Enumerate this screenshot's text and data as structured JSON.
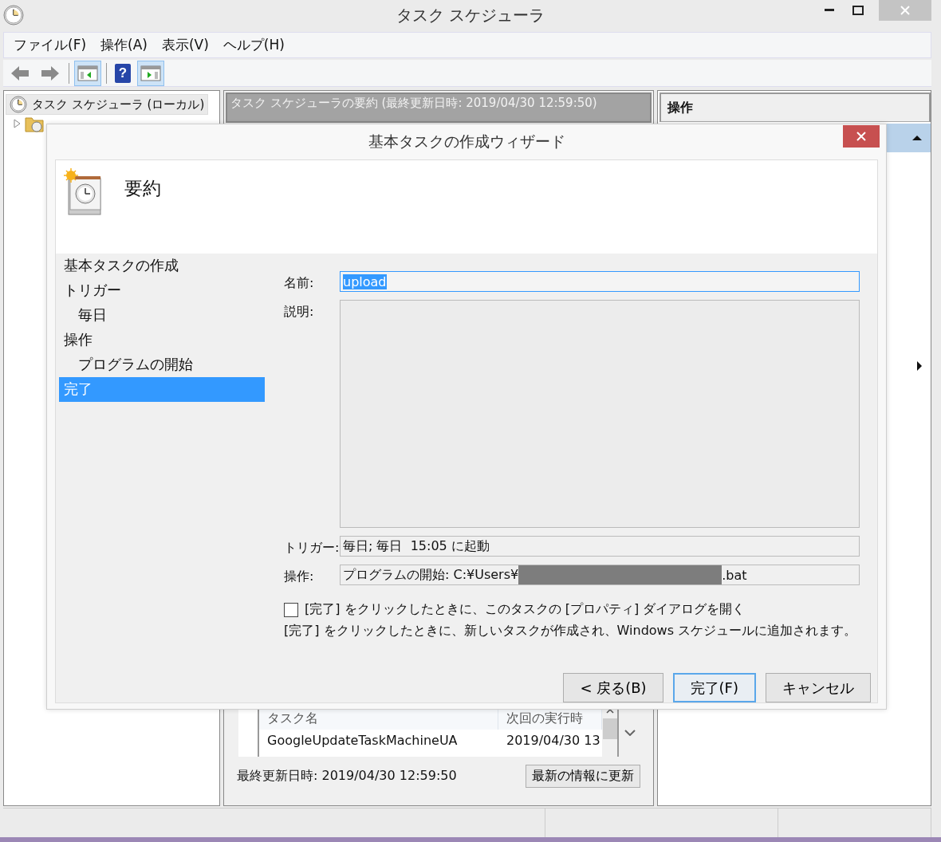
{
  "window": {
    "title": "タスク スケジューラ"
  },
  "menu": [
    "ファイル(F)",
    "操作(A)",
    "表示(V)",
    "ヘルプ(H)"
  ],
  "toolbar": [
    {
      "kind": "back",
      "on": false
    },
    {
      "kind": "forward",
      "on": false
    },
    {
      "kind": "console-tree",
      "on": true
    },
    {
      "kind": "help",
      "on": false,
      "glyph": "?"
    },
    {
      "kind": "action-pane",
      "on": true
    }
  ],
  "tree": [
    {
      "label": "タスク スケジューラ (ローカル)",
      "selected": true,
      "children": [
        {
          "expanded": false
        }
      ]
    }
  ],
  "summary": {
    "title": "タスク スケジューラの要約 (最終更新日時: 2019/04/30 12:59:50)",
    "table": {
      "columns": [
        "タスク名",
        "次回の実行時"
      ],
      "rows": [
        [
          "GoogleUpdateTaskMachineUA",
          "2019/04/30 13"
        ]
      ]
    },
    "last_updated": "最終更新日時: 2019/04/30 12:59:50",
    "refresh_button": "最新の情報に更新"
  },
  "actions_pane": {
    "title": "操作"
  },
  "dialog": {
    "title": "基本タスクの作成ウィザード",
    "heading": "要約",
    "steps": [
      {
        "label": "基本タスクの作成",
        "selected": false
      },
      {
        "label": "トリガー",
        "selected": false,
        "children": [
          {
            "label": "毎日",
            "selected": false
          }
        ]
      },
      {
        "label": "操作",
        "selected": false,
        "children": [
          {
            "label": "プログラムの開始",
            "selected": false
          }
        ]
      },
      {
        "label": "完了",
        "selected": true
      }
    ],
    "fields": [
      {
        "kind": "input",
        "label": "名前:",
        "value": "upload",
        "focused": true
      },
      {
        "kind": "textarea",
        "label": "説明:",
        "focused": false
      },
      {
        "kind": "readonly",
        "label": "トリガー:",
        "value": "毎日; 毎日  15:05 に起動"
      },
      {
        "kind": "redacted",
        "label": "操作:",
        "value": "プログラムの開始: C:¥Users¥",
        "value_end": ".bat"
      }
    ],
    "open_properties": {
      "label": "[完了] をクリックしたときに、このタスクの [プロパティ] ダイアログを開く",
      "checked": false
    },
    "note": "[完了] をクリックしたときに、新しいタスクが作成され、Windows スケジュールに追加されます。",
    "buttons": [
      {
        "label": "< 戻る(B)",
        "default": false
      },
      {
        "label": "完了(F)",
        "default": true
      },
      {
        "label": "キャンセル",
        "default": false
      }
    ]
  }
}
